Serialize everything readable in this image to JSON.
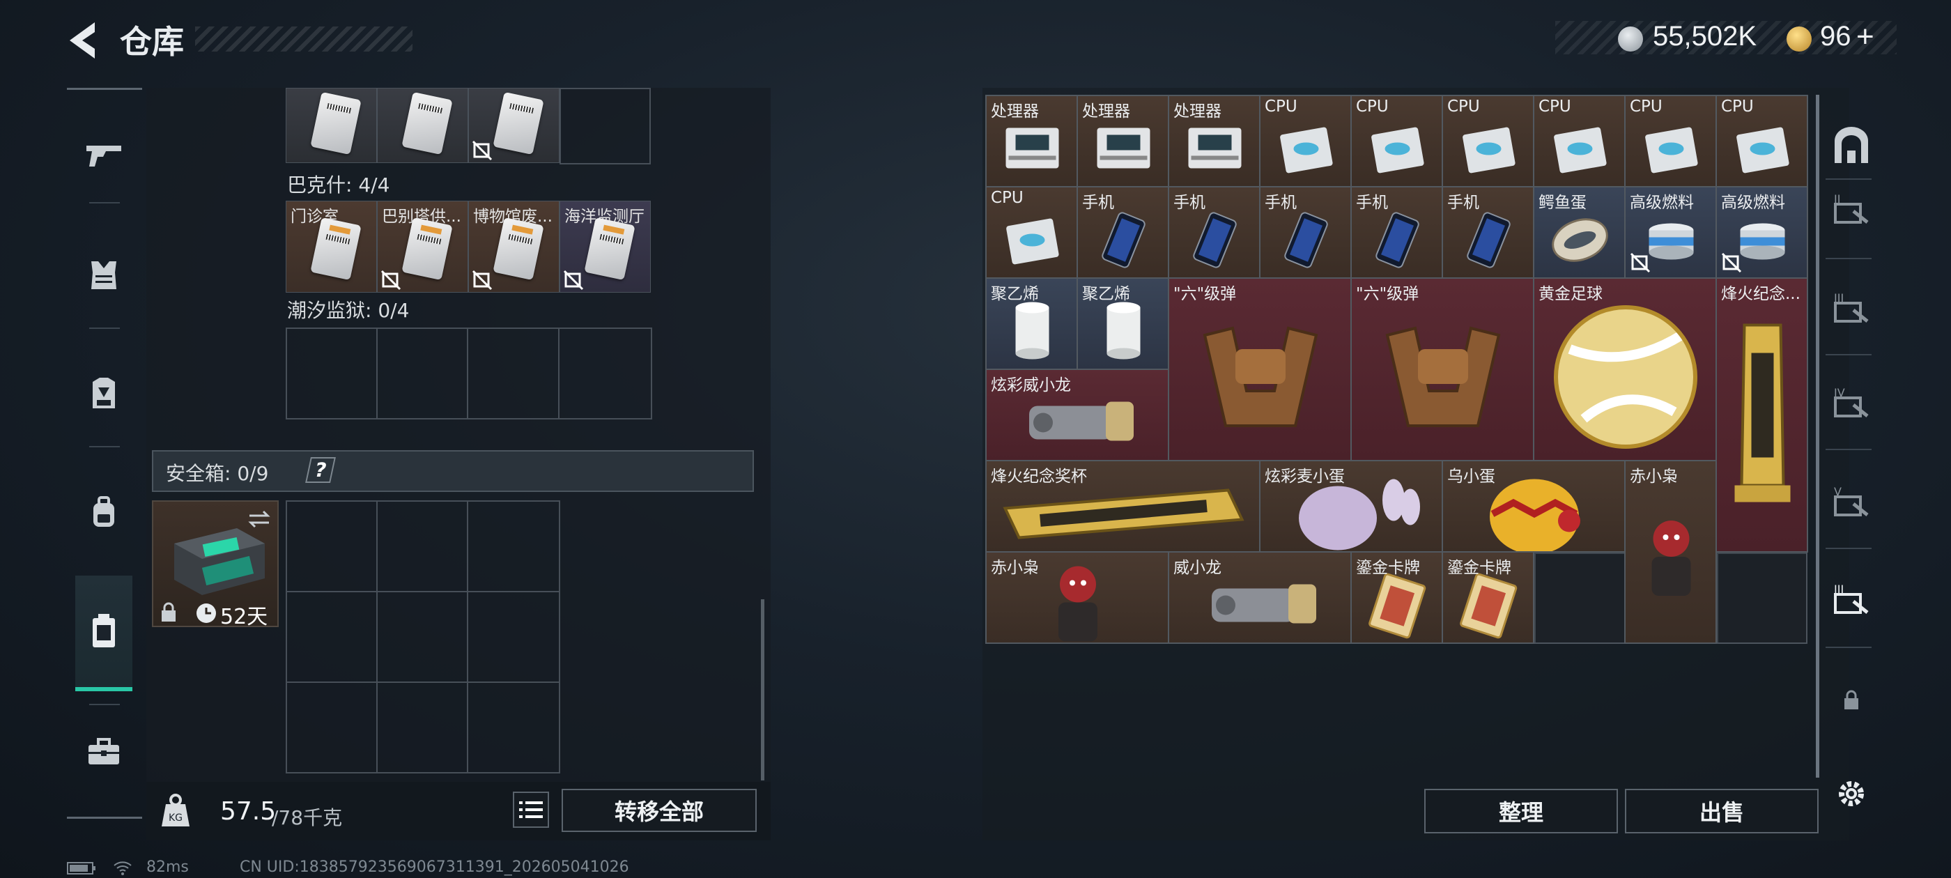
{
  "header": {
    "title": "仓库",
    "currency1": "55,502K",
    "currency2": "96",
    "add_label": "+"
  },
  "left_rail": {
    "items": [
      "weapon",
      "armor",
      "chest-rig",
      "backpack",
      "safe-box",
      "toolbox"
    ]
  },
  "left_panel": {
    "top_cards": [
      {
        "label": "",
        "locked": false
      },
      {
        "label": "",
        "locked": false
      },
      {
        "label": "",
        "locked": true
      }
    ],
    "section1": {
      "label": "巴克什: 4/4",
      "cards": [
        {
          "label": "门诊室",
          "locked": false
        },
        {
          "label": "巴别塔供...",
          "locked": true
        },
        {
          "label": "博物馆废...",
          "locked": true
        },
        {
          "label": "海洋监测厅",
          "locked": true
        }
      ]
    },
    "section2": {
      "label": "潮汐监狱: 0/4"
    },
    "safe_box": {
      "label": "安全箱: 0/9",
      "help": "?",
      "days": "52天"
    },
    "footer": {
      "weight": "57.5",
      "weight_max": "/78千克",
      "transfer_all": "转移全部"
    }
  },
  "right_panel": {
    "items": [
      {
        "label": "处理器",
        "type": "processor"
      },
      {
        "label": "处理器",
        "type": "processor"
      },
      {
        "label": "处理器",
        "type": "processor"
      },
      {
        "label": "CPU",
        "type": "cpu"
      },
      {
        "label": "CPU",
        "type": "cpu"
      },
      {
        "label": "CPU",
        "type": "cpu"
      },
      {
        "label": "CPU",
        "type": "cpu"
      },
      {
        "label": "CPU",
        "type": "cpu"
      },
      {
        "label": "CPU",
        "type": "cpu"
      },
      {
        "label": "CPU",
        "type": "cpu"
      },
      {
        "label": "手机",
        "type": "phone"
      },
      {
        "label": "手机",
        "type": "phone"
      },
      {
        "label": "手机",
        "type": "phone"
      },
      {
        "label": "手机",
        "type": "phone"
      },
      {
        "label": "手机",
        "type": "phone"
      },
      {
        "label": "鳄鱼蛋",
        "type": "egg"
      },
      {
        "label": "高级燃料",
        "type": "fuel"
      },
      {
        "label": "高级燃料",
        "type": "fuel"
      },
      {
        "label": "聚乙烯",
        "type": "roll"
      },
      {
        "label": "聚乙烯",
        "type": "roll"
      },
      {
        "label": "\"六\"级弹",
        "type": "gauntlet"
      },
      {
        "label": "\"六\"级弹",
        "type": "gauntlet"
      },
      {
        "label": "黄金足球",
        "type": "ball"
      },
      {
        "label": "烽火纪念...",
        "type": "trophy"
      },
      {
        "label": "炫彩威小龙",
        "type": "mech"
      },
      {
        "label": "烽火纪念奖杯",
        "type": "trophy-h"
      },
      {
        "label": "炫彩麦小蛋",
        "type": "bunny"
      },
      {
        "label": "乌小蛋",
        "type": "egg2"
      },
      {
        "label": "赤小枭",
        "type": "figure"
      },
      {
        "label": "赤小枭",
        "type": "figure"
      },
      {
        "label": "威小龙",
        "type": "mech"
      },
      {
        "label": "鎏金卡牌",
        "type": "card"
      },
      {
        "label": "鎏金卡牌",
        "type": "card"
      }
    ],
    "buttons": {
      "sort": "整理",
      "sell": "出售"
    }
  },
  "status_bar": {
    "ping": "82ms",
    "uid": "CN UID:183857923569067311391_202605041026"
  },
  "colors": {
    "accent": "#29c7a6",
    "brown_cell": "#4a3a30",
    "red_cell": "#5a2a33",
    "blue_cell": "#3a4558"
  }
}
